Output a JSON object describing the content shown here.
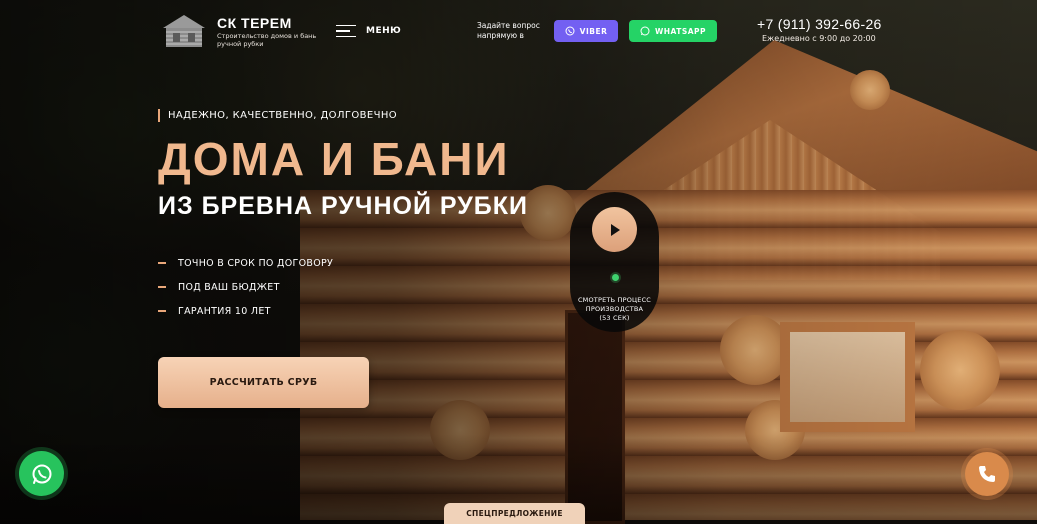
{
  "header": {
    "brand_title": "СК ТЕРЕМ",
    "brand_subtitle": "Строительство домов и бань ручной рубки",
    "menu_label": "МЕНЮ",
    "ask_text": "Задайте вопрос напрямую в",
    "viber_label": "VIBER",
    "whatsapp_label": "WHATSAPP",
    "phone": "+7 (911) 392-66-26",
    "hours": "Ежедневно с 9:00 до 20:00"
  },
  "hero": {
    "tagline": "НАДЕЖНО, КАЧЕСТВЕННО, ДОЛГОВЕЧНО",
    "title": "ДОМА И БАНИ",
    "subtitle": "ИЗ БРЕВНА РУЧНОЙ РУБКИ",
    "benefits": [
      "ТОЧНО В СРОК ПО ДОГОВОРУ",
      "ПОД ВАШ БЮДЖЕТ",
      "ГАРАНТИЯ 10 ЛЕТ"
    ],
    "cta_label": "РАССЧИТАТЬ СРУБ"
  },
  "video": {
    "caption_line1": "СМОТРЕТЬ ПРОЦЕСС",
    "caption_line2": "ПРОИЗВОДСТВА",
    "caption_line3": "(53 СЕК)"
  },
  "special_offer_label": "СПЕЦПРЕДЛОЖЕНИЕ",
  "colors": {
    "accent": "#f0b88e",
    "viber": "#7360f2",
    "whatsapp": "#25d366",
    "phone_fab": "#d98a4b"
  },
  "icons": {
    "logo": "log-house-icon",
    "menu": "hamburger-icon",
    "viber": "viber-icon",
    "whatsapp": "whatsapp-icon",
    "play": "play-icon",
    "phone": "phone-icon"
  }
}
